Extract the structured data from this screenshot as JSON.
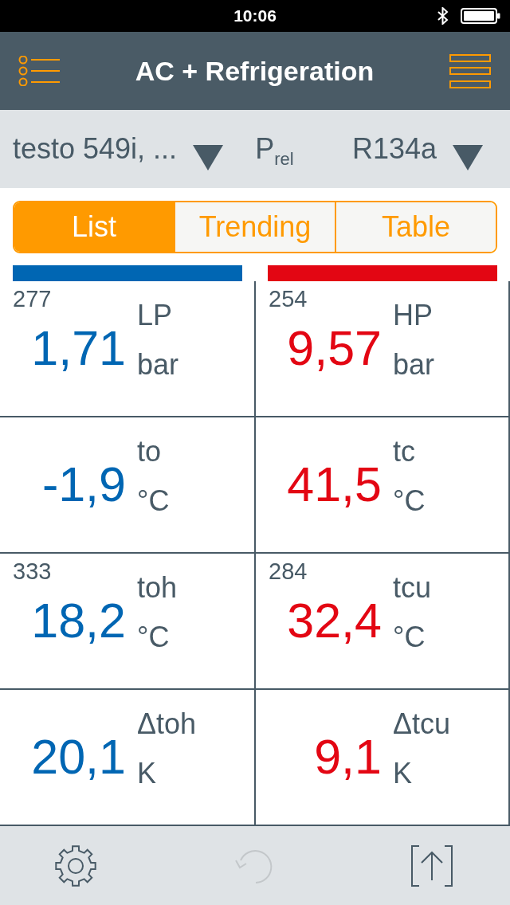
{
  "status_bar": {
    "time": "10:06"
  },
  "header": {
    "title": "AC + Refrigeration"
  },
  "selector_bar": {
    "probe": "testo 549i, ...",
    "pressure_mode": "P$_{rel}$",
    "refrigerant": "R134a"
  },
  "view_tabs": [
    {
      "label": "List",
      "selected": true
    },
    {
      "label": "Trending",
      "selected": false
    },
    {
      "label": "Table",
      "selected": false
    }
  ],
  "columns": [
    {
      "color": "#0066b3",
      "readings": [
        {
          "sensor_id": "277",
          "value": "1,71",
          "name": "LP",
          "unit": "bar"
        },
        {
          "value": "-1,9",
          "name": "to",
          "unit": "°C"
        },
        {
          "sensor_id": "333",
          "value": "18,2",
          "name": "toh",
          "unit": "°C"
        },
        {
          "value": "20,1",
          "name": "Δtoh",
          "unit": "K"
        }
      ]
    },
    {
      "color": "#e30613",
      "readings": [
        {
          "sensor_id": "254",
          "value": "9,57",
          "name": "HP",
          "unit": "bar"
        },
        {
          "value": "41,5",
          "name": "tc",
          "unit": "°C"
        },
        {
          "sensor_id": "284",
          "value": "32,4",
          "name": "tcu",
          "unit": "°C"
        },
        {
          "value": "9,1",
          "name": "Δtcu",
          "unit": "K"
        }
      ]
    }
  ],
  "toolbar": [
    {
      "kind": "settings",
      "disabled": false
    },
    {
      "kind": "undo",
      "disabled": true
    },
    {
      "kind": "share",
      "disabled": false
    }
  ]
}
